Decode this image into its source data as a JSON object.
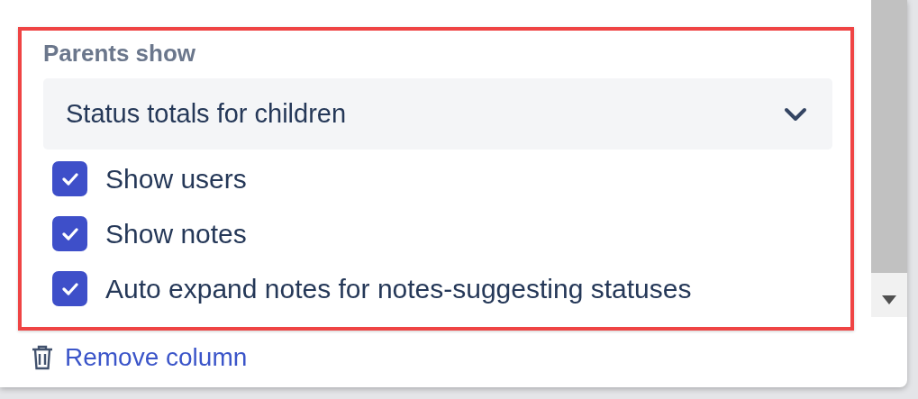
{
  "section": {
    "label": "Parents show",
    "select": {
      "value": "Status totals for children"
    },
    "options": [
      {
        "label": "Show users",
        "checked": true
      },
      {
        "label": "Show notes",
        "checked": true
      },
      {
        "label": "Auto expand notes for notes-suggesting statuses",
        "checked": true
      }
    ]
  },
  "remove_link": {
    "label": "Remove column"
  }
}
